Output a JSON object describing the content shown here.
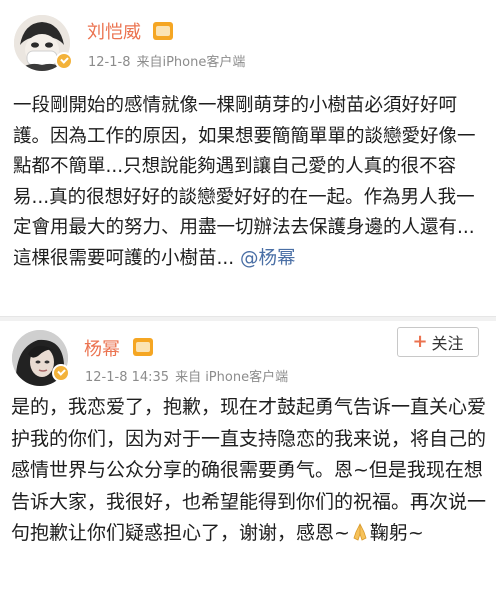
{
  "post1": {
    "author": "刘恺威",
    "time": "12-1-8",
    "source": "来自iPhone客户端",
    "text": "一段剛開始的感情就像一棵剛萌芽的小樹苗必須好好呵護。因為工作的原因，如果想要簡簡單單的談戀愛好像一點都不簡單...只想說能夠遇到讓自己愛的人真的很不容易...真的很想好好的談戀愛好好的在一起。作為男人我一定會用最大的努力、用盡一切辦法去保護身邊的人還有...這棵很需要呵護的小樹苗... ",
    "mention": "@杨幂",
    "avatar_icon": "avatar-masked-face-icon",
    "badge_color": "#f3b23a"
  },
  "post2": {
    "author": "杨幂",
    "time": "12-1-8 14:35",
    "source": "来自 iPhone客户端",
    "follow_label": "关注",
    "text_before_emoji": "是的，我恋爱了，抱歉，现在才鼓起勇气告诉一直关心爱护我的你们，因为对于一直支持隐恋的我来说，将自己的感情世界与公众分享的确很需要勇气。恩~但是我现在想告诉大家，我很好，也希望能得到你们的祝福。再次说一句抱歉让你们疑惑担心了，谢谢，感恩~",
    "text_after_emoji": "鞠躬~",
    "emoji_icon": "praying-hands-icon",
    "avatar_icon": "avatar-woman-photo-icon"
  },
  "colors": {
    "name": "#eb7350",
    "meta": "#8c8c8c",
    "mention": "#4a6fa5",
    "vip": "#f5a623"
  }
}
